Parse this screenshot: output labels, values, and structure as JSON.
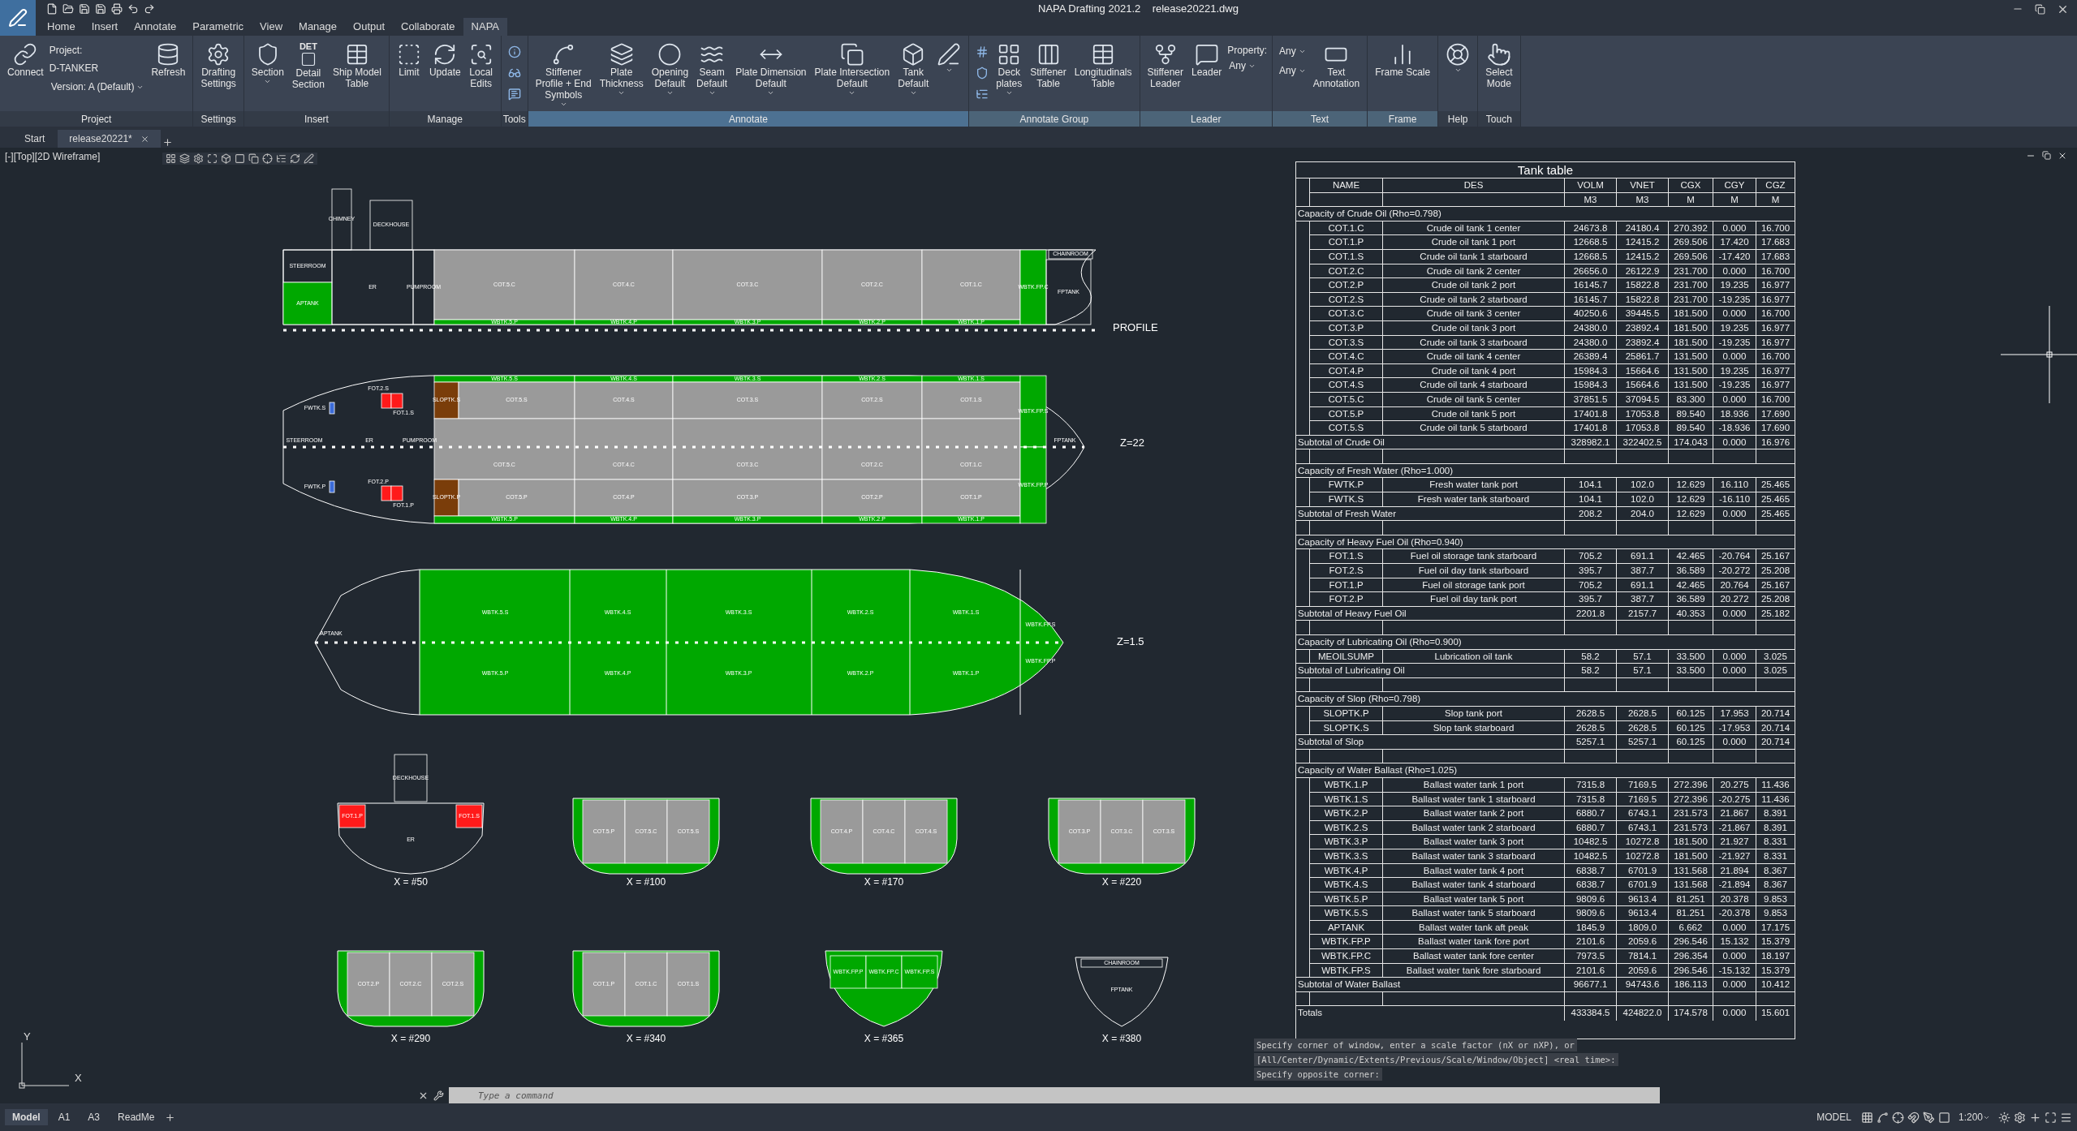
{
  "app": {
    "title": "NAPA Drafting 2021.2",
    "file": "release20221.dwg"
  },
  "menu_tabs": [
    {
      "label": "Home",
      "selected": false
    },
    {
      "label": "Insert",
      "selected": false
    },
    {
      "label": "Annotate",
      "selected": false
    },
    {
      "label": "Parametric",
      "selected": false
    },
    {
      "label": "View",
      "selected": false
    },
    {
      "label": "Manage",
      "selected": false
    },
    {
      "label": "Output",
      "selected": false
    },
    {
      "label": "Collaborate",
      "selected": false
    },
    {
      "label": "NAPA",
      "selected": true
    }
  ],
  "ribbon": [
    {
      "title": "Project",
      "kind": "plain",
      "items": [
        {
          "kind": "large",
          "label": "Connect",
          "dropdown": false
        },
        {
          "kind": "project",
          "lines": [
            "Project:",
            "D-TANKER"
          ],
          "version": "Version: A (Default)"
        },
        {
          "kind": "large",
          "label": "Refresh",
          "dropdown": false
        }
      ]
    },
    {
      "title": "Settings",
      "kind": "plain",
      "items": [
        {
          "kind": "large",
          "label": "Drafting\nSettings",
          "dropdown": false
        }
      ]
    },
    {
      "title": "Insert",
      "kind": "plain",
      "items": [
        {
          "kind": "large",
          "label": "Section",
          "dropdown": true
        },
        {
          "kind": "large",
          "label": "Detail\nSection",
          "badge": "DET",
          "dropdown": false
        },
        {
          "kind": "large",
          "label": "Ship Model\nTable",
          "dropdown": false
        }
      ]
    },
    {
      "title": "Manage",
      "kind": "plain",
      "items": [
        {
          "kind": "large",
          "label": "Limit",
          "dropdown": false
        },
        {
          "kind": "large",
          "label": "Update",
          "dropdown": false
        },
        {
          "kind": "large",
          "label": "Local\nEdits",
          "dropdown": false
        }
      ]
    },
    {
      "title": "Tools",
      "kind": "plain",
      "items": [
        {
          "kind": "small"
        },
        {
          "kind": "small"
        },
        {
          "kind": "small"
        }
      ]
    },
    {
      "title": "Annotate",
      "kind": "active",
      "items": [
        {
          "kind": "large",
          "label": "Stiffener\nProfile + End\nSymbols",
          "dropdown": true
        },
        {
          "kind": "large",
          "label": "Plate\nThickness",
          "dropdown": true
        },
        {
          "kind": "large",
          "label": "Opening\nDefault",
          "dropdown": true
        },
        {
          "kind": "large",
          "label": "Seam\nDefault",
          "dropdown": true
        },
        {
          "kind": "large",
          "label": "Plate Dimension\nDefault",
          "dropdown": true
        },
        {
          "kind": "large",
          "label": "Plate Intersection\nDefault",
          "dropdown": true
        },
        {
          "kind": "large",
          "label": "Tank\nDefault",
          "dropdown": true
        },
        {
          "kind": "large",
          "dropdown": true
        }
      ]
    },
    {
      "title": "Annotate Group",
      "kind": "tinted",
      "items": [
        {
          "kind": "small"
        },
        {
          "kind": "small"
        },
        {
          "kind": "small"
        },
        {
          "kind": "large",
          "label": "Deck\nplates",
          "dropdown": true
        },
        {
          "kind": "large",
          "label": "Stiffener\nTable",
          "dropdown": false
        },
        {
          "kind": "large",
          "label": "Longitudinals\nTable",
          "dropdown": false
        }
      ]
    },
    {
      "title": "Leader",
      "kind": "tinted",
      "items": [
        {
          "kind": "large",
          "label": "Stiffener\nLeader",
          "dropdown": false
        },
        {
          "kind": "large",
          "label": "Leader",
          "dropdown": false
        },
        {
          "kind": "select",
          "label": "Property:",
          "value": "Any"
        }
      ]
    },
    {
      "title": "Text",
      "kind": "tinted",
      "items": [
        {
          "kind": "select",
          "value": "Any"
        },
        {
          "kind": "select",
          "value": "Any"
        },
        {
          "kind": "large",
          "label": "Text\nAnnotation",
          "dropdown": false
        }
      ]
    },
    {
      "title": "Frame",
      "kind": "tinted",
      "items": [
        {
          "kind": "large",
          "label": "Frame Scale",
          "dropdown": false
        }
      ]
    },
    {
      "title": "Help",
      "kind": "plain",
      "items": [
        {
          "kind": "large",
          "dropdown": true
        }
      ]
    },
    {
      "title": "Touch",
      "kind": "plain",
      "items": [
        {
          "kind": "large",
          "label": "Select\nMode",
          "dropdown": false
        }
      ]
    }
  ],
  "doc_tabs": [
    {
      "label": "Start",
      "selected": false,
      "closable": false
    },
    {
      "label": "release20221*",
      "selected": true,
      "closable": true
    }
  ],
  "viewport": {
    "label": "[-][Top][2D Wireframe]"
  },
  "drawing": {
    "profile": {
      "label": "PROFILE",
      "compartments": [
        {
          "label": "STEERROOM",
          "kind": "space"
        },
        {
          "label": "APTANK",
          "kind": "ballast"
        },
        {
          "label": "ER",
          "kind": "space"
        },
        {
          "label": "PUMPROOM",
          "kind": "space"
        },
        {
          "label": "CHIMNEY",
          "kind": "space"
        },
        {
          "label": "DECKHOUSE",
          "kind": "space"
        },
        {
          "label": "COT.5.C",
          "kind": "cargo"
        },
        {
          "label": "COT.4.C",
          "kind": "cargo"
        },
        {
          "label": "COT.3.C",
          "kind": "cargo"
        },
        {
          "label": "COT.2.C",
          "kind": "cargo"
        },
        {
          "label": "COT.1.C",
          "kind": "cargo"
        },
        {
          "label": "WBTK.5.P",
          "kind": "ballast"
        },
        {
          "label": "WBTK.4.P",
          "kind": "ballast"
        },
        {
          "label": "WBTK.3.P",
          "kind": "ballast"
        },
        {
          "label": "WBTK.2.P",
          "kind": "ballast"
        },
        {
          "label": "WBTK.1.P",
          "kind": "ballast"
        },
        {
          "label": "WBTK.FP.C",
          "kind": "ballast"
        },
        {
          "label": "FPTANK",
          "kind": "space"
        },
        {
          "label": "CHAINROOM",
          "kind": "space"
        }
      ]
    },
    "plan_deck": {
      "label": "Z=22",
      "compartments": [
        {
          "label": "WBTK.5.S",
          "kind": "ballast"
        },
        {
          "label": "WBTK.4.S",
          "kind": "ballast"
        },
        {
          "label": "WBTK.3.S",
          "kind": "ballast"
        },
        {
          "label": "WBTK.2.S",
          "kind": "ballast"
        },
        {
          "label": "WBTK.1.S",
          "kind": "ballast"
        },
        {
          "label": "SLOPTK.S",
          "kind": "slop"
        },
        {
          "label": "COT.5.S",
          "kind": "cargo"
        },
        {
          "label": "COT.4.S",
          "kind": "cargo"
        },
        {
          "label": "COT.3.S",
          "kind": "cargo"
        },
        {
          "label": "COT.2.S",
          "kind": "cargo"
        },
        {
          "label": "COT.1.S",
          "kind": "cargo"
        },
        {
          "label": "COT.5.C",
          "kind": "cargo"
        },
        {
          "label": "COT.4.C",
          "kind": "cargo"
        },
        {
          "label": "COT.3.C",
          "kind": "cargo"
        },
        {
          "label": "COT.2.C",
          "kind": "cargo"
        },
        {
          "label": "COT.1.C",
          "kind": "cargo"
        },
        {
          "label": "SLOPTK.P",
          "kind": "slop"
        },
        {
          "label": "COT.5.P",
          "kind": "cargo"
        },
        {
          "label": "COT.4.P",
          "kind": "cargo"
        },
        {
          "label": "COT.3.P",
          "kind": "cargo"
        },
        {
          "label": "COT.2.P",
          "kind": "cargo"
        },
        {
          "label": "COT.1.P",
          "kind": "cargo"
        },
        {
          "label": "WBTK.5.P",
          "kind": "ballast"
        },
        {
          "label": "WBTK.4.P",
          "kind": "ballast"
        },
        {
          "label": "WBTK.3.P",
          "kind": "ballast"
        },
        {
          "label": "WBTK.2.P",
          "kind": "ballast"
        },
        {
          "label": "WBTK.1.P",
          "kind": "ballast"
        },
        {
          "label": "WBTK.FP.S",
          "kind": "ballast"
        },
        {
          "label": "WBTK.FP.P",
          "kind": "ballast"
        },
        {
          "label": "FOT.2.S",
          "kind": "fuel"
        },
        {
          "label": "FOT.1.S",
          "kind": "fuel"
        },
        {
          "label": "FOT.2.P",
          "kind": "fuel"
        },
        {
          "label": "FOT.1.P",
          "kind": "fuel"
        },
        {
          "label": "FWTK.S",
          "kind": "fresh"
        },
        {
          "label": "STEERROOM",
          "kind": "label"
        },
        {
          "label": "ER",
          "kind": "label"
        },
        {
          "label": "PUMPROOM",
          "kind": "label"
        },
        {
          "label": "FPTANK",
          "kind": "label"
        },
        {
          "label": "FWTK.P",
          "kind": "fresh"
        }
      ]
    },
    "plan_bottom": {
      "label": "Z=1.5",
      "compartments": [
        {
          "label": "WBTK.5.S",
          "kind": "label"
        },
        {
          "label": "WBTK.4.S",
          "kind": "label"
        },
        {
          "label": "WBTK.3.S",
          "kind": "label"
        },
        {
          "label": "WBTK.2.S",
          "kind": "label"
        },
        {
          "label": "WBTK.1.S",
          "kind": "label"
        },
        {
          "label": "WBTK.5.P",
          "kind": "label"
        },
        {
          "label": "WBTK.4.P",
          "kind": "label"
        },
        {
          "label": "WBTK.3.P",
          "kind": "label"
        },
        {
          "label": "WBTK.2.P",
          "kind": "label"
        },
        {
          "label": "WBTK.1.P",
          "kind": "label"
        },
        {
          "label": "WBTK.FP.S",
          "kind": "label"
        },
        {
          "label": "WBTK.FP.P",
          "kind": "label"
        },
        {
          "label": "APTANK",
          "kind": "label"
        }
      ]
    },
    "sections": [
      {
        "label": "X = #50",
        "kind": "engine",
        "compartments": [
          {
            "label": "DECKHOUSE",
            "kind": "space"
          },
          {
            "label": "FOT.1.P",
            "kind": "fuel"
          },
          {
            "label": "FOT.1.S",
            "kind": "fuel"
          },
          {
            "label": "ER",
            "kind": "label"
          }
        ]
      },
      {
        "label": "X = #100",
        "kind": "cargo",
        "compartments": [
          {
            "label": "COT.5.P",
            "kind": "cargo"
          },
          {
            "label": "COT.5.C",
            "kind": "cargo"
          },
          {
            "label": "COT.5.S",
            "kind": "cargo"
          }
        ]
      },
      {
        "label": "X = #170",
        "kind": "cargo",
        "compartments": [
          {
            "label": "COT.4.P",
            "kind": "cargo"
          },
          {
            "label": "COT.4.C",
            "kind": "cargo"
          },
          {
            "label": "COT.4.S",
            "kind": "cargo"
          }
        ]
      },
      {
        "label": "X = #220",
        "kind": "cargo",
        "compartments": [
          {
            "label": "COT.3.P",
            "kind": "cargo"
          },
          {
            "label": "COT.3.C",
            "kind": "cargo"
          },
          {
            "label": "COT.3.S",
            "kind": "cargo"
          }
        ]
      },
      {
        "label": "X = #290",
        "kind": "cargo",
        "compartments": [
          {
            "label": "COT.2.P",
            "kind": "cargo"
          },
          {
            "label": "COT.2.C",
            "kind": "cargo"
          },
          {
            "label": "COT.2.S",
            "kind": "cargo"
          }
        ]
      },
      {
        "label": "X = #340",
        "kind": "cargo",
        "compartments": [
          {
            "label": "COT.1.P",
            "kind": "cargo"
          },
          {
            "label": "COT.1.C",
            "kind": "cargo"
          },
          {
            "label": "COT.1.S",
            "kind": "cargo"
          }
        ]
      },
      {
        "label": "X = #365",
        "kind": "fore",
        "compartments": [
          {
            "label": "WBTK.FP.P",
            "kind": "ballast"
          },
          {
            "label": "WBTK.FP.C",
            "kind": "ballast"
          },
          {
            "label": "WBTK.FP.S",
            "kind": "ballast"
          }
        ]
      },
      {
        "label": "X = #380",
        "kind": "bow",
        "compartments": [
          {
            "label": "CHAINROOM",
            "kind": "space"
          },
          {
            "label": "FPTANK",
            "kind": "label"
          }
        ]
      }
    ],
    "axes": {
      "x": "X",
      "y": "Y"
    }
  },
  "tank_table": {
    "title": "Tank table",
    "columns": [
      {
        "name": "NAME"
      },
      {
        "name": "DES"
      },
      {
        "name": "VOLM",
        "unit": "M3"
      },
      {
        "name": "VNET",
        "unit": "M3"
      },
      {
        "name": "CGX",
        "unit": "M"
      },
      {
        "name": "CGY",
        "unit": "M"
      },
      {
        "name": "CGZ",
        "unit": "M"
      }
    ],
    "sections": [
      {
        "heading": "Capacity of Crude Oil (Rho=0.798)",
        "rows": [
          [
            "COT.1.C",
            "Crude oil tank 1 center",
            "24673.8",
            "24180.4",
            "270.392",
            "0.000",
            "16.700"
          ],
          [
            "COT.1.P",
            "Crude oil tank 1 port",
            "12668.5",
            "12415.2",
            "269.506",
            "17.420",
            "17.683"
          ],
          [
            "COT.1.S",
            "Crude oil tank 1 starboard",
            "12668.5",
            "12415.2",
            "269.506",
            "-17.420",
            "17.683"
          ],
          [
            "COT.2.C",
            "Crude oil tank 2 center",
            "26656.0",
            "26122.9",
            "231.700",
            "0.000",
            "16.700"
          ],
          [
            "COT.2.P",
            "Crude oil tank 2 port",
            "16145.7",
            "15822.8",
            "231.700",
            "19.235",
            "16.977"
          ],
          [
            "COT.2.S",
            "Crude oil tank 2 starboard",
            "16145.7",
            "15822.8",
            "231.700",
            "-19.235",
            "16.977"
          ],
          [
            "COT.3.C",
            "Crude oil tank 3 center",
            "40250.6",
            "39445.5",
            "181.500",
            "0.000",
            "16.700"
          ],
          [
            "COT.3.P",
            "Crude oil tank 3 port",
            "24380.0",
            "23892.4",
            "181.500",
            "19.235",
            "16.977"
          ],
          [
            "COT.3.S",
            "Crude oil tank 3 starboard",
            "24380.0",
            "23892.4",
            "181.500",
            "-19.235",
            "16.977"
          ],
          [
            "COT.4.C",
            "Crude oil tank 4 center",
            "26389.4",
            "25861.7",
            "131.500",
            "0.000",
            "16.700"
          ],
          [
            "COT.4.P",
            "Crude oil tank 4 port",
            "15984.3",
            "15664.6",
            "131.500",
            "19.235",
            "16.977"
          ],
          [
            "COT.4.S",
            "Crude oil tank 4 starboard",
            "15984.3",
            "15664.6",
            "131.500",
            "-19.235",
            "16.977"
          ],
          [
            "COT.5.C",
            "Crude oil tank 5 center",
            "37851.5",
            "37094.5",
            "83.300",
            "0.000",
            "16.700"
          ],
          [
            "COT.5.P",
            "Crude oil tank 5 port",
            "17401.8",
            "17053.8",
            "89.540",
            "18.936",
            "17.690"
          ],
          [
            "COT.5.S",
            "Crude oil tank 5 starboard",
            "17401.8",
            "17053.8",
            "89.540",
            "-18.936",
            "17.690"
          ]
        ],
        "subtotal": [
          "Subtotal of Crude Oil",
          "328982.1",
          "322402.5",
          "174.043",
          "0.000",
          "16.976"
        ]
      },
      {
        "heading": "Capacity of Fresh Water (Rho=1.000)",
        "rows": [
          [
            "FWTK.P",
            "Fresh water tank port",
            "104.1",
            "102.0",
            "12.629",
            "16.110",
            "25.465"
          ],
          [
            "FWTK.S",
            "Fresh water tank starboard",
            "104.1",
            "102.0",
            "12.629",
            "-16.110",
            "25.465"
          ]
        ],
        "subtotal": [
          "Subtotal of Fresh Water",
          "208.2",
          "204.0",
          "12.629",
          "0.000",
          "25.465"
        ]
      },
      {
        "heading": "Capacity of Heavy Fuel Oil (Rho=0.940)",
        "rows": [
          [
            "FOT.1.S",
            "Fuel oil storage tank starboard",
            "705.2",
            "691.1",
            "42.465",
            "-20.764",
            "25.167"
          ],
          [
            "FOT.2.S",
            "Fuel oil day tank starboard",
            "395.7",
            "387.7",
            "36.589",
            "-20.272",
            "25.208"
          ],
          [
            "FOT.1.P",
            "Fuel oil storage tank port",
            "705.2",
            "691.1",
            "42.465",
            "20.764",
            "25.167"
          ],
          [
            "FOT.2.P",
            "Fuel oil day tank port",
            "395.7",
            "387.7",
            "36.589",
            "20.272",
            "25.208"
          ]
        ],
        "subtotal": [
          "Subtotal of Heavy Fuel Oil",
          "2201.8",
          "2157.7",
          "40.353",
          "0.000",
          "25.182"
        ]
      },
      {
        "heading": "Capacity of Lubricating Oil (Rho=0.900)",
        "rows": [
          [
            "MEOILSUMP",
            "Lubrication oil tank",
            "58.2",
            "57.1",
            "33.500",
            "0.000",
            "3.025"
          ]
        ],
        "subtotal": [
          "Subtotal of Lubricating Oil",
          "58.2",
          "57.1",
          "33.500",
          "0.000",
          "3.025"
        ]
      },
      {
        "heading": "Capacity of Slop (Rho=0.798)",
        "rows": [
          [
            "SLOPTK.P",
            "Slop tank port",
            "2628.5",
            "2628.5",
            "60.125",
            "17.953",
            "20.714"
          ],
          [
            "SLOPTK.S",
            "Slop tank starboard",
            "2628.5",
            "2628.5",
            "60.125",
            "-17.953",
            "20.714"
          ]
        ],
        "subtotal": [
          "Subtotal of Slop",
          "5257.1",
          "5257.1",
          "60.125",
          "0.000",
          "20.714"
        ]
      },
      {
        "heading": "Capacity of Water Ballast (Rho=1.025)",
        "rows": [
          [
            "WBTK.1.P",
            "Ballast water tank 1 port",
            "7315.8",
            "7169.5",
            "272.396",
            "20.275",
            "11.436"
          ],
          [
            "WBTK.1.S",
            "Ballast water tank 1 starboard",
            "7315.8",
            "7169.5",
            "272.396",
            "-20.275",
            "11.436"
          ],
          [
            "WBTK.2.P",
            "Ballast water tank 2 port",
            "6880.7",
            "6743.1",
            "231.573",
            "21.867",
            "8.391"
          ],
          [
            "WBTK.2.S",
            "Ballast water tank 2 starboard",
            "6880.7",
            "6743.1",
            "231.573",
            "-21.867",
            "8.391"
          ],
          [
            "WBTK.3.P",
            "Ballast water tank 3 port",
            "10482.5",
            "10272.8",
            "181.500",
            "21.927",
            "8.331"
          ],
          [
            "WBTK.3.S",
            "Ballast water tank 3 starboard",
            "10482.5",
            "10272.8",
            "181.500",
            "-21.927",
            "8.331"
          ],
          [
            "WBTK.4.P",
            "Ballast water tank 4 port",
            "6838.7",
            "6701.9",
            "131.568",
            "21.894",
            "8.367"
          ],
          [
            "WBTK.4.S",
            "Ballast water tank 4 starboard",
            "6838.7",
            "6701.9",
            "131.568",
            "-21.894",
            "8.367"
          ],
          [
            "WBTK.5.P",
            "Ballast water tank 5 port",
            "9809.6",
            "9613.4",
            "81.251",
            "20.378",
            "9.853"
          ],
          [
            "WBTK.5.S",
            "Ballast water tank 5 starboard",
            "9809.6",
            "9613.4",
            "81.251",
            "-20.378",
            "9.853"
          ],
          [
            "APTANK",
            "Ballast water tank aft peak",
            "1845.9",
            "1809.0",
            "6.662",
            "0.000",
            "17.175"
          ],
          [
            "WBTK.FP.P",
            "Ballast water tank fore port",
            "2101.6",
            "2059.6",
            "296.546",
            "15.132",
            "15.379"
          ],
          [
            "WBTK.FP.C",
            "Ballast water tank fore center",
            "7973.5",
            "7814.1",
            "296.354",
            "0.000",
            "18.197"
          ],
          [
            "WBTK.FP.S",
            "Ballast water tank fore starboard",
            "2101.6",
            "2059.6",
            "296.546",
            "-15.132",
            "15.379"
          ]
        ],
        "subtotal": [
          "Subtotal of Water Ballast",
          "96677.1",
          "94743.6",
          "186.113",
          "0.000",
          "10.412"
        ]
      }
    ],
    "totals": [
      "Totals",
      "433384.5",
      "424822.0",
      "174.578",
      "0.000",
      "15.601"
    ]
  },
  "command": {
    "history": [
      "Specify corner of window, enter a scale factor (nX or nXP), or",
      "[All/Center/Dynamic/Extents/Previous/Scale/Window/Object] <real time>:",
      "Specify opposite corner:"
    ],
    "placeholder": "Type a command"
  },
  "layout_tabs": [
    {
      "label": "Model",
      "selected": true
    },
    {
      "label": "A1",
      "selected": false
    },
    {
      "label": "A3",
      "selected": false
    },
    {
      "label": "ReadMe",
      "selected": false
    }
  ],
  "status": {
    "space": "MODEL",
    "scale": "1:200"
  }
}
